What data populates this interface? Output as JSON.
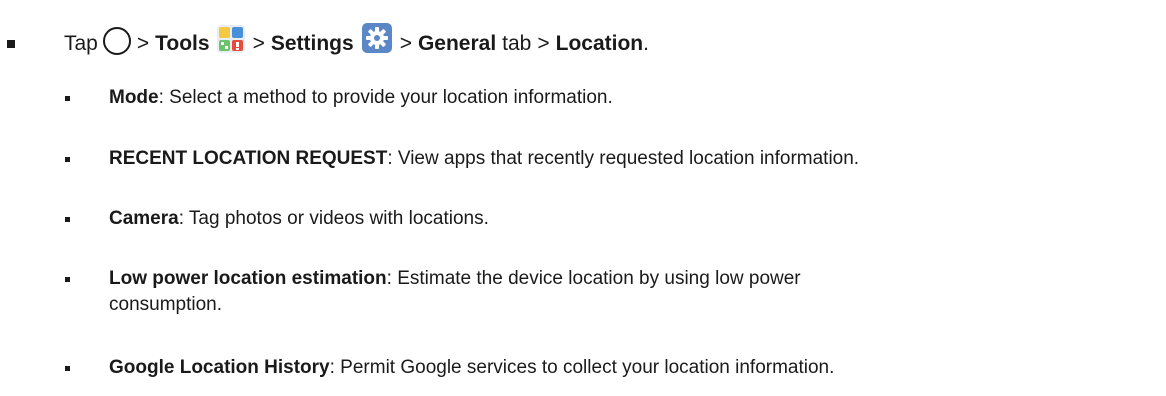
{
  "instruction": {
    "bullet": "■",
    "tap": "Tap",
    "sep": ">",
    "tools": "Tools",
    "settings": "Settings",
    "general": "General",
    "tab": "tab",
    "location": "Location",
    "period": ".",
    "icons": [
      "home-circle-icon",
      "tools-folder-icon",
      "settings-gear-icon"
    ],
    "colors": {
      "tools_blue": "#4a90d9",
      "tools_red": "#e84a3c",
      "tools_yellow": "#f5c842",
      "settings_bg": "#5b87c7"
    }
  },
  "items": [
    {
      "title": "Mode",
      "desc": ": Select a method to provide your location information."
    },
    {
      "title": "RECENT LOCATION REQUEST",
      "desc": ": View apps that recently requested location information."
    },
    {
      "title": "Camera",
      "desc": ": Tag photos or videos with locations."
    },
    {
      "title": "Low power location estimation",
      "desc": ": Estimate the device location by using low power",
      "desc_line2": "consumption."
    },
    {
      "title": "Google Location History",
      "desc": ": Permit Google services to collect your location information."
    }
  ]
}
